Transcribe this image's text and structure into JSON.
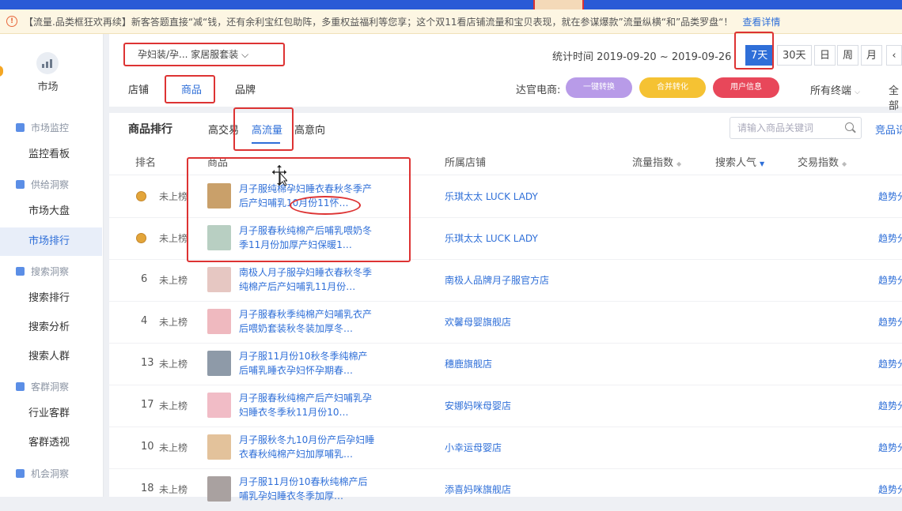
{
  "notice": {
    "text": "【流量.品类框狂欢再续】新客答题直接“减“钱，还有余利宝红包助阵，多重权益福利等您享；这个双11看店铺流量和宝贝表现，就在参谋爆款”流量纵横“和”品类罗盘“！",
    "link": "查看详情"
  },
  "sidebar": {
    "logo_label": "市场",
    "groups": [
      {
        "label": "市场监控",
        "items": [
          "监控看板"
        ]
      },
      {
        "label": "供给洞察",
        "items": [
          "市场大盘",
          "市场排行"
        ]
      },
      {
        "label": "搜索洞察",
        "items": [
          "搜索排行",
          "搜索分析",
          "搜索人群"
        ]
      },
      {
        "label": "客群洞察",
        "items": [
          "行业客群",
          "客群透视"
        ]
      },
      {
        "label": "机会洞察",
        "items": []
      }
    ],
    "active_item": "市场排行"
  },
  "header": {
    "category": "孕妇装/孕... 家居服套装",
    "stat_time": "统计时间 2019-09-20 ~ 2019-09-26",
    "periods": [
      "7天",
      "30天",
      "日",
      "周",
      "月"
    ],
    "active_period": "7天",
    "tabs": [
      "店铺",
      "商品",
      "品牌"
    ],
    "active_tab": "商品",
    "daguan_label": "达官电商:",
    "pills": [
      {
        "label": "一键转换",
        "color": "#b89be8"
      },
      {
        "label": "合并转化",
        "color": "#f5c233"
      },
      {
        "label": "用户信息",
        "color": "#e8475a"
      }
    ],
    "terminal": "所有终端",
    "all_label": "全部"
  },
  "ranking": {
    "title": "商品排行",
    "subtabs": [
      "高交易",
      "高流量",
      "高意向"
    ],
    "active_subtab": "高流量",
    "search_placeholder": "请输入商品关键词",
    "compare_link": "竞品识",
    "columns": [
      "排名",
      "商品",
      "所属店铺",
      "流量指数",
      "搜索人气",
      "交易指数"
    ],
    "rows": [
      {
        "rank": "",
        "medal": true,
        "status": "未上榜",
        "product": "月子服纯棉孕妇睡衣春秋冬季产后产妇哺乳10月份11怀…",
        "shop": "乐琪太太 LUCK LADY",
        "trend": "趋势分",
        "thumb": "#c9a06a"
      },
      {
        "rank": "",
        "medal": true,
        "status": "未上榜",
        "product": "月子服春秋纯棉产后哺乳喂奶冬季11月份加厚产妇保暖1…",
        "shop": "乐琪太太 LUCK LADY",
        "trend": "趋势分",
        "thumb": "#b8cfc2"
      },
      {
        "rank": "6",
        "medal": false,
        "status": "未上榜",
        "product": "南极人月子服孕妇睡衣春秋冬季纯棉产后产妇哺乳11月份…",
        "shop": "南极人品牌月子服官方店",
        "trend": "趋势分",
        "thumb": "#e6c7c2"
      },
      {
        "rank": "4",
        "medal": false,
        "status": "未上榜",
        "product": "月子服春秋季纯棉产妇哺乳衣产后喂奶套装秋冬装加厚冬…",
        "shop": "欢馨母婴旗舰店",
        "trend": "趋势分",
        "thumb": "#efb9bf"
      },
      {
        "rank": "13",
        "medal": false,
        "status": "未上榜",
        "product": "月子服11月份10秋冬季纯棉产后哺乳睡衣孕妇怀孕期春…",
        "shop": "穗鹿旗舰店",
        "trend": "趋势分",
        "thumb": "#8e9aa8"
      },
      {
        "rank": "17",
        "medal": false,
        "status": "未上榜",
        "product": "月子服春秋纯棉产后产妇哺乳孕妇睡衣冬季秋11月份10…",
        "shop": "安娜妈咪母婴店",
        "trend": "趋势分",
        "thumb": "#f1bcc6"
      },
      {
        "rank": "10",
        "medal": false,
        "status": "未上榜",
        "product": "月子服秋冬九10月份产后孕妇睡衣春秋纯棉产妇加厚哺乳…",
        "shop": "小幸运母婴店",
        "trend": "趋势分",
        "thumb": "#e3c29b"
      },
      {
        "rank": "18",
        "medal": false,
        "status": "未上榜",
        "product": "月子服11月份10春秋纯棉产后哺乳孕妇睡衣冬季加厚…",
        "shop": "添喜妈咪旗舰店",
        "trend": "趋势分",
        "thumb": "#a9a1a0"
      }
    ]
  }
}
